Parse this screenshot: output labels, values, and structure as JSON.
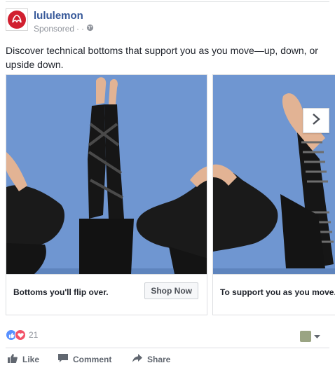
{
  "post": {
    "page_name": "lululemon",
    "sponsored_label": "Sponsored",
    "separator": "·",
    "caption": "Discover technical bottoms that support you as you move—up, down, or upside down."
  },
  "carousel": {
    "cards": [
      {
        "title": "Bottoms you'll flip over.",
        "cta": "Shop Now"
      },
      {
        "title": "To support you as you move."
      }
    ],
    "next_icon": "chevron-right-icon"
  },
  "reactions": {
    "count": "21",
    "icons": [
      "like-reaction-icon",
      "love-reaction-icon"
    ]
  },
  "actions": {
    "like_label": "Like",
    "comment_label": "Comment",
    "share_label": "Share"
  },
  "colors": {
    "link_blue": "#365899",
    "photo_background": "#6f96d1",
    "brand_red": "#d11f2f"
  }
}
